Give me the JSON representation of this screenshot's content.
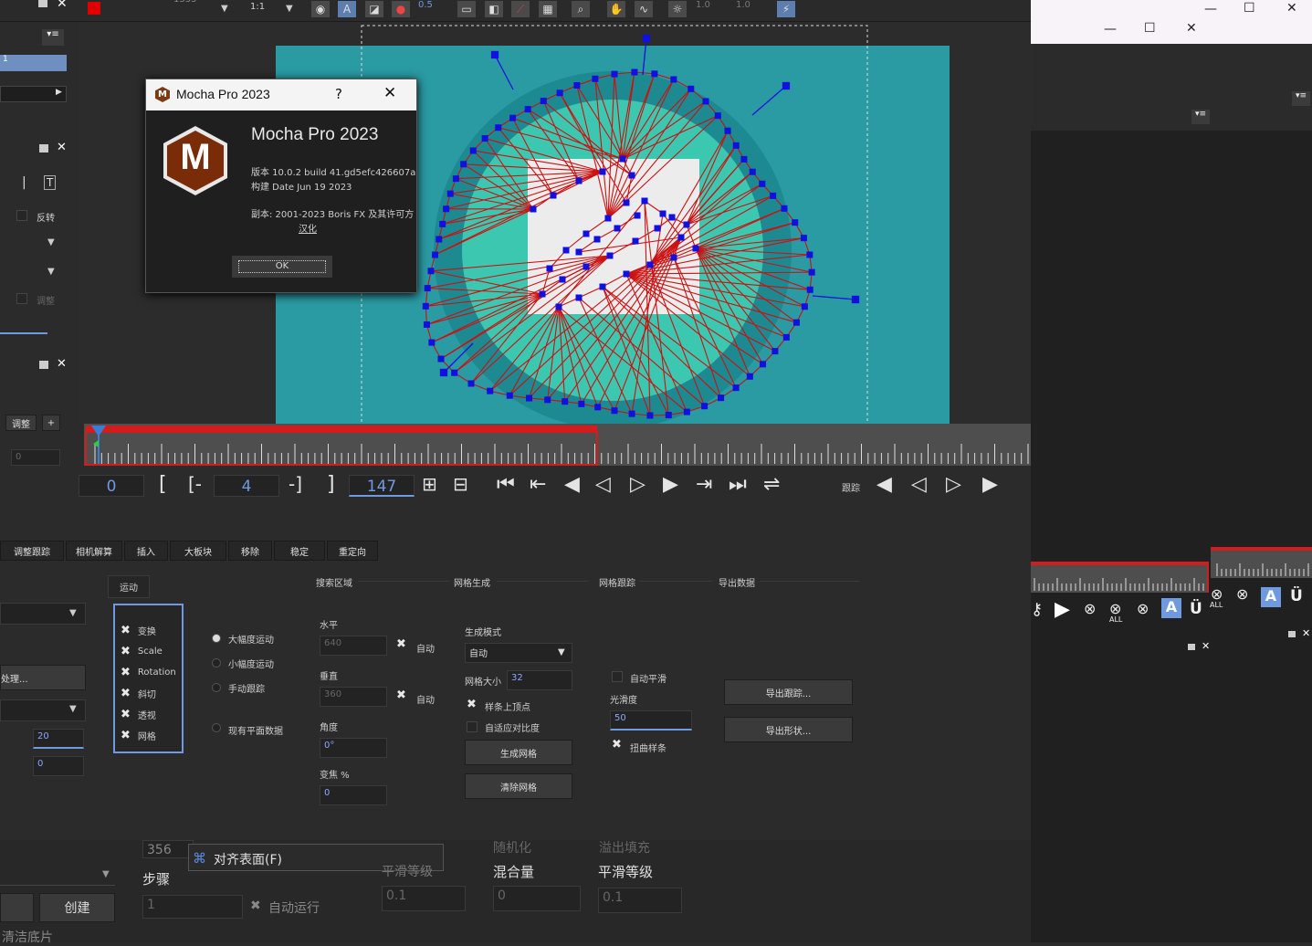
{
  "toolbar": {
    "zoom_ratio": "1:1",
    "value_05": "0.5",
    "value_10a": "1.0",
    "value_10b": "1.0",
    "frame_trunc": "1335"
  },
  "about_dialog": {
    "window_title": "Mocha Pro 2023",
    "help": "?",
    "close": "✕",
    "product_name": "Mocha Pro 2023",
    "logo_letter": "M",
    "version_line": "版本 10.0.2 build 41.gd5efc426607a",
    "build_line": "构建 Date Jun 19 2023",
    "copyright_line": "副本: 2001-2023 Boris FX 及其许可方",
    "localization": "汉化",
    "ok_label": "OK"
  },
  "left_panel": {
    "layer_value": "1",
    "invert_label": "反转",
    "adjust_label_dim": "调整",
    "adjust_button": "调整",
    "add_button": "+",
    "frame_field": "0"
  },
  "timeline": {
    "current_frame": "0",
    "in_bracket": "[",
    "in_dash": "[-",
    "step": "4",
    "out_dash": "-]",
    "out_bracket": "]",
    "end_frame": "147",
    "track_label": "跟踪"
  },
  "module_tabs": [
    "调整跟踪",
    "相机解算",
    "插入",
    "大板块",
    "移除",
    "稳定",
    "重定向"
  ],
  "params": {
    "motion_header": "运动",
    "motion_items": [
      "变换",
      "Scale",
      "Rotation",
      "斜切",
      "透视",
      "网格"
    ],
    "radio_items": [
      "大幅度运动",
      "小幅度运动",
      "手动跟踪"
    ],
    "existing_plane": "现有平面数据",
    "search_header": "搜索区域",
    "horizontal_label": "水平",
    "horizontal_value": "640",
    "auto_label": "自动",
    "vertical_label": "垂直",
    "vertical_value": "360",
    "angle_label": "角度",
    "angle_value": "0°",
    "zoom_label": "变焦 %",
    "zoom_value": "0",
    "mesh_gen_header": "网格生成",
    "gen_mode_label": "生成模式",
    "gen_mode_value": "自动",
    "mesh_size_label": "网格大小",
    "mesh_size_value": "32",
    "spline_vertices": "样条上顶点",
    "adaptive_contrast": "自适应对比度",
    "gen_mesh_button": "生成网格",
    "clear_mesh_button": "清除网格",
    "mesh_track_header": "网格跟踪",
    "auto_smooth": "自动平滑",
    "smoothness_label": "光滑度",
    "smoothness_value": "50",
    "warp_spline": "扭曲样条",
    "export_header": "导出数据",
    "export_tracking": "导出跟踪...",
    "export_shape": "导出形状...",
    "left_param_20": "20",
    "left_param_0": "0",
    "left_process": "处理..."
  },
  "underlay": {
    "value_356": "356",
    "menu_align": "对齐表面(F)",
    "step_label": "步骤",
    "step_value": "1",
    "auto_run": "自动运行",
    "create_button": "创建",
    "blend_label": "混合量",
    "blend_value": "0",
    "smooth_level_label": "平滑等级",
    "smooth_level_value": "0.1",
    "val_01": "0.1",
    "bottom_trunc": "清洁底片",
    "frac_label": "平滑等级",
    "randomize": "随机化",
    "overflow_fill": "溢出填充"
  },
  "right_panel": {
    "all1": "ALL",
    "all2": "ALL",
    "a_label": "A",
    "u_label": "Ü"
  },
  "colors": {
    "accent_blue": "#6f9ae0",
    "track_red": "#d11d1d",
    "mesh_blue": "#1010e0",
    "canvas_teal": "#2a9aa3"
  }
}
